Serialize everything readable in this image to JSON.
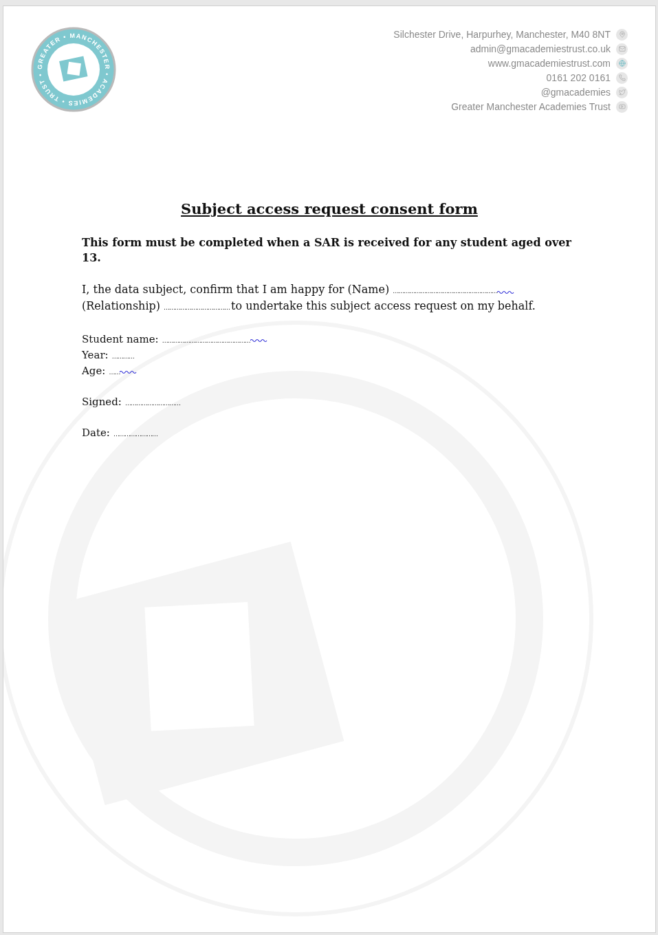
{
  "logo": {
    "ring_text": "GREATER • MANCHESTER • ACADEMIES • TRUST •"
  },
  "contacts": [
    {
      "kind": "pin",
      "text": "Silchester Drive, Harpurhey, Manchester, M40 8NT"
    },
    {
      "kind": "mail",
      "text": "admin@gmacademiestrust.co.uk"
    },
    {
      "kind": "web",
      "text": "www.gmacademiestrust.com"
    },
    {
      "kind": "phone",
      "text": "0161 202 0161"
    },
    {
      "kind": "twitter",
      "text": "@gmacademies"
    },
    {
      "kind": "video",
      "text": "Greater Manchester Academies Trust"
    }
  ],
  "title": "Subject access request consent form",
  "intro": "This form must be completed when a SAR is received for any student aged over 13.",
  "consent": [
    {
      "text": "I, the data subject, confirm that I am happy for (Name) ",
      "blank": "…………………………………………………",
      "spelling_flag": true
    },
    {
      "text": "(Relationship) ",
      "blank": "……………………………… "
    },
    {
      "text": "to undertake this subject access request on my behalf."
    }
  ],
  "field_groups": [
    [
      {
        "label": "Student name:",
        "blank": "…………………………………………",
        "spelling_flag": true
      },
      {
        "label": "Year:",
        "blank": "…………"
      },
      {
        "label": "Age:",
        "blank": "……",
        "spelling_flag": true
      }
    ],
    [
      {
        "label": "Signed:",
        "blank": "…………………………"
      }
    ],
    [
      {
        "label": "Date:",
        "blank": "……………………"
      }
    ]
  ]
}
